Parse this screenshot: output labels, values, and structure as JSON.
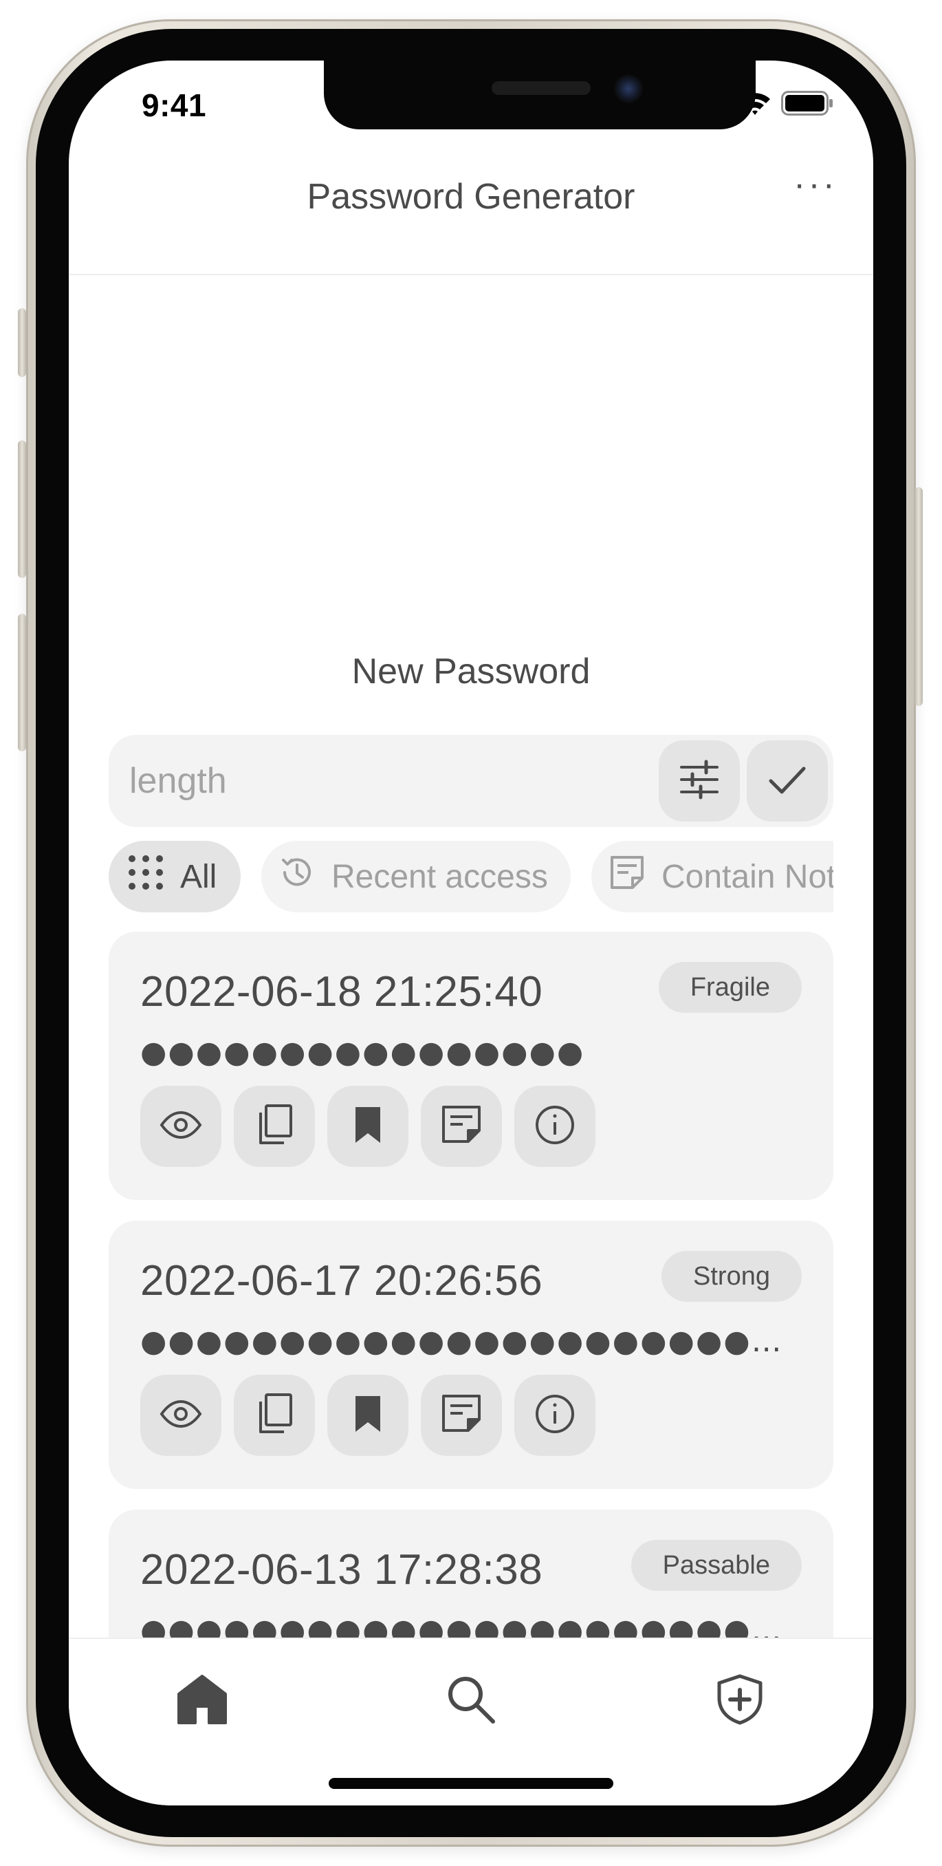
{
  "status_bar": {
    "time": "9:41"
  },
  "header": {
    "title": "Password Generator",
    "more_label": "···"
  },
  "new_password": {
    "title": "New Password",
    "length_input": {
      "placeholder": "length",
      "value": ""
    }
  },
  "filters": [
    {
      "label": "All",
      "icon": "grid-icon",
      "active": true
    },
    {
      "label": "Recent access",
      "icon": "history-icon",
      "active": false
    },
    {
      "label": "Contain Note",
      "icon": "note-icon",
      "active": false
    }
  ],
  "passwords": [
    {
      "date": "2022-06-18 21:25:40",
      "strength": "Fragile",
      "masked": "●●●●●●●●●●●●●●●●"
    },
    {
      "date": "2022-06-17 20:26:56",
      "strength": "Strong",
      "masked": "●●●●●●●●●●●●●●●●●●●●●●●●●●●●●●●●●●●●●●●●"
    },
    {
      "date": "2022-06-13 17:28:38",
      "strength": "Passable",
      "masked": "●●●●●●●●●●●●●●●●●●●●●●●●●●●●●●●●●●●●●●●●"
    }
  ],
  "card_actions": [
    "eye-icon",
    "copy-icon",
    "bookmark-icon",
    "note-icon",
    "info-icon"
  ],
  "tabbar": [
    {
      "name": "home",
      "icon": "home-icon",
      "active": true
    },
    {
      "name": "search",
      "icon": "search-icon",
      "active": false
    },
    {
      "name": "security",
      "icon": "shield-plus-icon",
      "active": false
    }
  ],
  "colors": {
    "text": "#4a4a4a",
    "muted": "#a0a0a0",
    "card_bg": "#f2f3f2",
    "button_bg": "#e3e3e3"
  }
}
